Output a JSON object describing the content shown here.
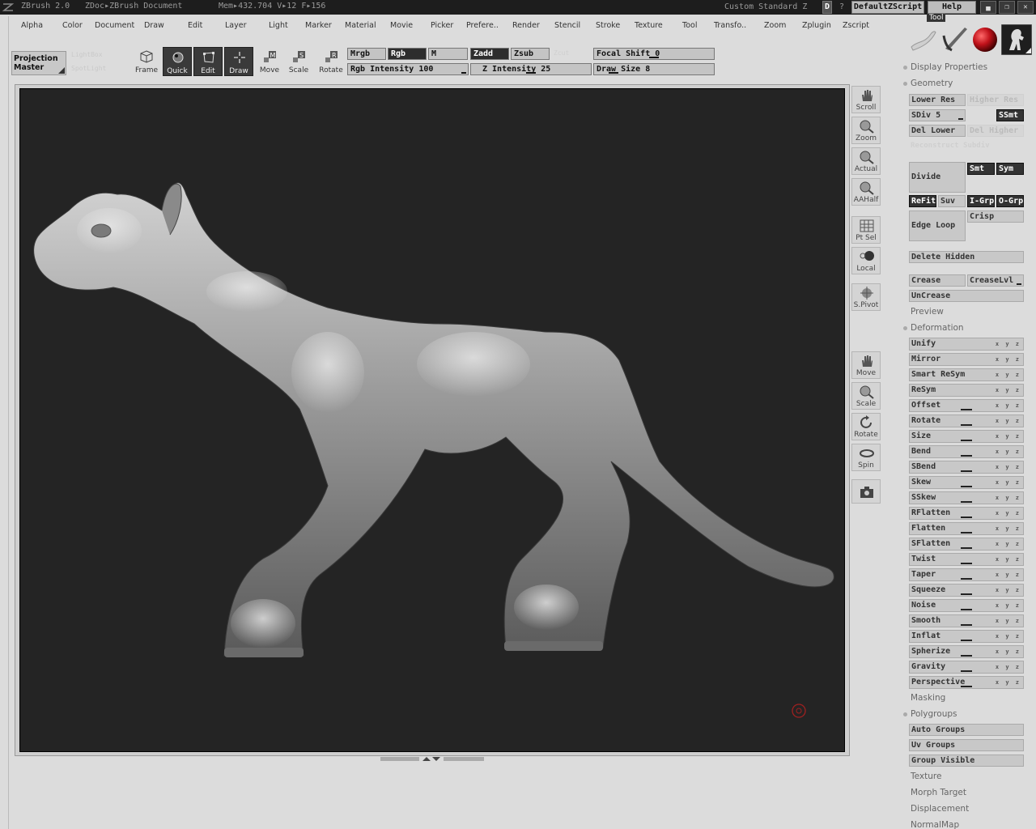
{
  "titlebar": {
    "app": "ZBrush 2.0",
    "doc": "ZDoc▸ZBrush Document",
    "mem": "Mem▸432.704 V▸12 F▸156",
    "layout": "Custom Standard Z",
    "d_btn": "D",
    "q_btn": "?",
    "script_btn": "DefaultZScript",
    "help_btn": "Help"
  },
  "menu": [
    "Alpha",
    "Color",
    "Document",
    "Draw",
    "Edit",
    "Layer",
    "Light",
    "Marker",
    "Material",
    "Movie",
    "Picker",
    "Prefere..",
    "Render",
    "Stencil",
    "Stroke",
    "Texture",
    "Tool",
    "Transfo..",
    "Zoom",
    "Zplugin",
    "Zscript"
  ],
  "toolbar": {
    "projection_master": "Projection Master",
    "ghost1": "LightBox",
    "ghost2": "SpotLight",
    "tools": [
      "Frame",
      "Quick",
      "Edit",
      "Draw",
      "Move",
      "Scale",
      "Rotate"
    ],
    "mrgb": "Mrgb",
    "rgb": "Rgb",
    "m": "M",
    "zadd": "Zadd",
    "zsub": "Zsub",
    "zcut": "Zcut",
    "rgb_intensity_label": "Rgb Intensity",
    "rgb_intensity": "100",
    "z_intensity_label": "Z Intensity",
    "z_intensity": "25",
    "focal_shift_label": "Focal Shift",
    "focal_shift": "0",
    "draw_size_label": "Draw Size",
    "draw_size": "8"
  },
  "side_tools": [
    "Scroll",
    "Zoom",
    "Actual",
    "AAHalf",
    "Pt Sel",
    "Local",
    "S.Pivot",
    "Move",
    "Scale",
    "Rotate",
    "Spin"
  ],
  "right_panel": {
    "tool_label": "Tool",
    "display_properties": "Display Properties",
    "geometry": "Geometry",
    "lower_res": "Lower Res",
    "higher_res": "Higher Res",
    "sdiv_label": "SDiv",
    "sdiv": "5",
    "ssmt": "SSmt",
    "del_lower": "Del Lower",
    "del_higher": "Del Higher",
    "reconstruct": "Reconstruct Subdiv",
    "divide": "Divide",
    "smt": "Smt",
    "sym": "Sym",
    "refit": "ReFit",
    "suv": "Suv",
    "igrp": "I-Grp",
    "ogrp": "O-Grp",
    "edge_loop": "Edge Loop",
    "crisp": "Crisp",
    "delete_hidden": "Delete Hidden",
    "crease": "Crease",
    "crease_lvl": "CreaseLvl",
    "uncrease": "UnCrease",
    "preview": "Preview",
    "deformation": "Deformation",
    "deform_items": [
      "Unify",
      "Mirror",
      "Smart ReSym",
      "ReSym",
      "Offset",
      "Rotate",
      "Size",
      "Bend",
      "SBend",
      "Skew",
      "SSkew",
      "RFlatten",
      "Flatten",
      "SFlatten",
      "Twist",
      "Taper",
      "Squeeze",
      "Noise",
      "Smooth",
      "Inflat",
      "Spherize",
      "Gravity",
      "Perspective"
    ],
    "masking": "Masking",
    "polygroups": "Polygroups",
    "auto_groups": "Auto Groups",
    "uv_groups": "Uv Groups",
    "group_visible": "Group Visible",
    "texture": "Texture",
    "morph_target": "Morph Target",
    "displacement": "Displacement",
    "normalmap": "NormalMap"
  },
  "colors": {
    "canvas": "#242424",
    "panel": "#dcdcdc",
    "material_red": "#c0121a",
    "titlebar": "#1d1d1d"
  }
}
